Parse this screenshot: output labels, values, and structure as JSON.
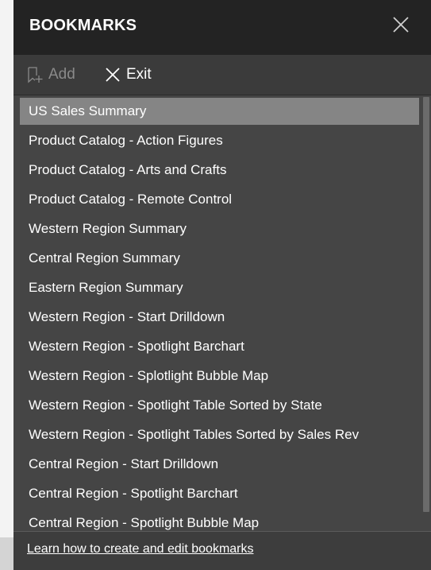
{
  "header": {
    "title": "BOOKMARKS",
    "close_icon": "close-icon"
  },
  "toolbar": {
    "add_label": "Add",
    "add_icon": "add-bookmark-icon",
    "exit_label": "Exit",
    "exit_icon": "close-icon"
  },
  "bookmarks": [
    {
      "label": "US Sales Summary",
      "selected": true
    },
    {
      "label": "Product Catalog - Action Figures"
    },
    {
      "label": "Product Catalog - Arts and Crafts"
    },
    {
      "label": "Product Catalog - Remote Control"
    },
    {
      "label": "Western Region Summary"
    },
    {
      "label": "Central Region Summary"
    },
    {
      "label": "Eastern Region Summary"
    },
    {
      "label": "Western Region - Start Drilldown"
    },
    {
      "label": "Western Region - Spotlight Barchart"
    },
    {
      "label": "Western Region - Splotlight Bubble Map"
    },
    {
      "label": "Western Region - Spotlight Table Sorted by State"
    },
    {
      "label": "Western Region - Spotlight Tables Sorted by Sales Rev"
    },
    {
      "label": "Central Region - Start Drilldown"
    },
    {
      "label": "Central Region - Spotlight Barchart"
    },
    {
      "label": "Central Region - Spotlight Bubble Map"
    }
  ],
  "footer": {
    "link_label": "Learn how to create and edit bookmarks"
  },
  "colors": {
    "header_bg": "#232323",
    "toolbar_bg": "#3b3b3b",
    "panel_bg": "#454545",
    "selected_bg": "#858585",
    "disabled_text": "#8a8a8a"
  }
}
